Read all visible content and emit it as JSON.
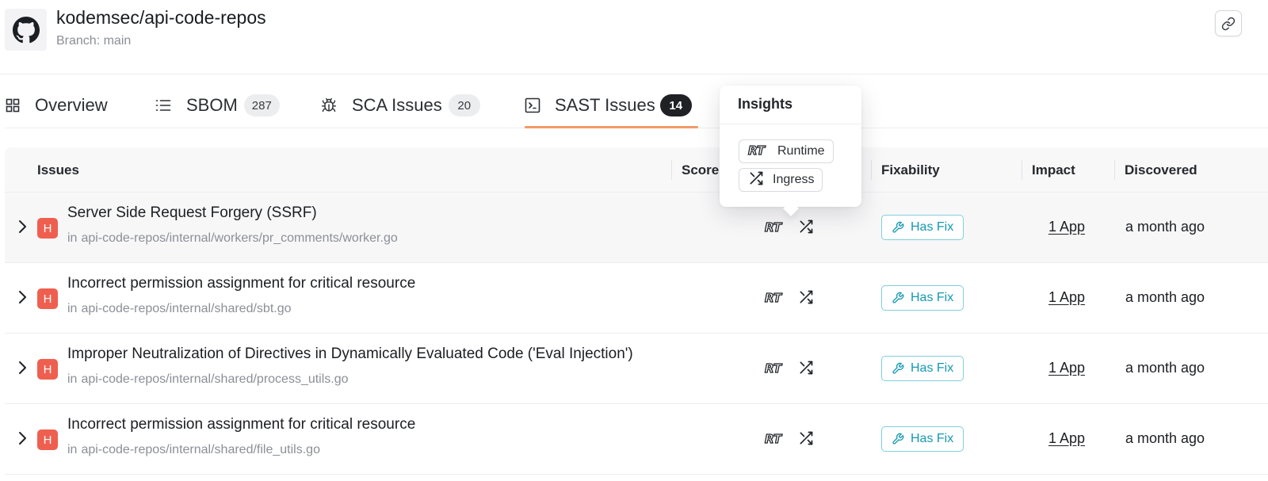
{
  "repo": {
    "name": "kodemsec/api-code-repos",
    "branch": "Branch: main"
  },
  "tabs": [
    {
      "label": "Overview",
      "icon": "grid-icon"
    },
    {
      "label": "SBOM",
      "count": "287",
      "icon": "list-icon"
    },
    {
      "label": "SCA Issues",
      "count": "20",
      "icon": "bug-icon"
    },
    {
      "label": "SAST Issues",
      "count": "14",
      "icon": "terminal-icon",
      "active": true
    }
  ],
  "table": {
    "columns": [
      "Issues",
      "Score",
      "Fixability",
      "Impact",
      "Discovered"
    ],
    "rows": [
      {
        "severity": "H",
        "title": "Server Side Request Forgery (SSRF)",
        "in": "in",
        "path": "api-code-repos/internal/workers/pr_comments/worker.go",
        "fix": "Has Fix",
        "impact": "1 App",
        "discovered": "a month ago"
      },
      {
        "severity": "H",
        "title": "Incorrect permission assignment for critical resource",
        "in": "in",
        "path": "api-code-repos/internal/shared/sbt.go",
        "fix": "Has Fix",
        "impact": "1 App",
        "discovered": "a month ago"
      },
      {
        "severity": "H",
        "title": "Improper Neutralization of Directives in Dynamically Evaluated Code ('Eval Injection')",
        "in": "in",
        "path": "api-code-repos/internal/shared/process_utils.go",
        "fix": "Has Fix",
        "impact": "1 App",
        "discovered": "a month ago"
      },
      {
        "severity": "H",
        "title": "Incorrect permission assignment for critical resource",
        "in": "in",
        "path": "api-code-repos/internal/shared/file_utils.go",
        "fix": "Has Fix",
        "impact": "1 App",
        "discovered": "a month ago"
      }
    ]
  },
  "tooltip": {
    "title": "Insights",
    "items": [
      {
        "label": "Runtime",
        "icon": "runtime-rt-icon"
      },
      {
        "label": "Ingress",
        "icon": "ingress-icon"
      }
    ]
  },
  "colors": {
    "severity_high": "#ef5f4f",
    "fix_accent": "#1599b3",
    "active_tab_underline": "#f29a68"
  }
}
